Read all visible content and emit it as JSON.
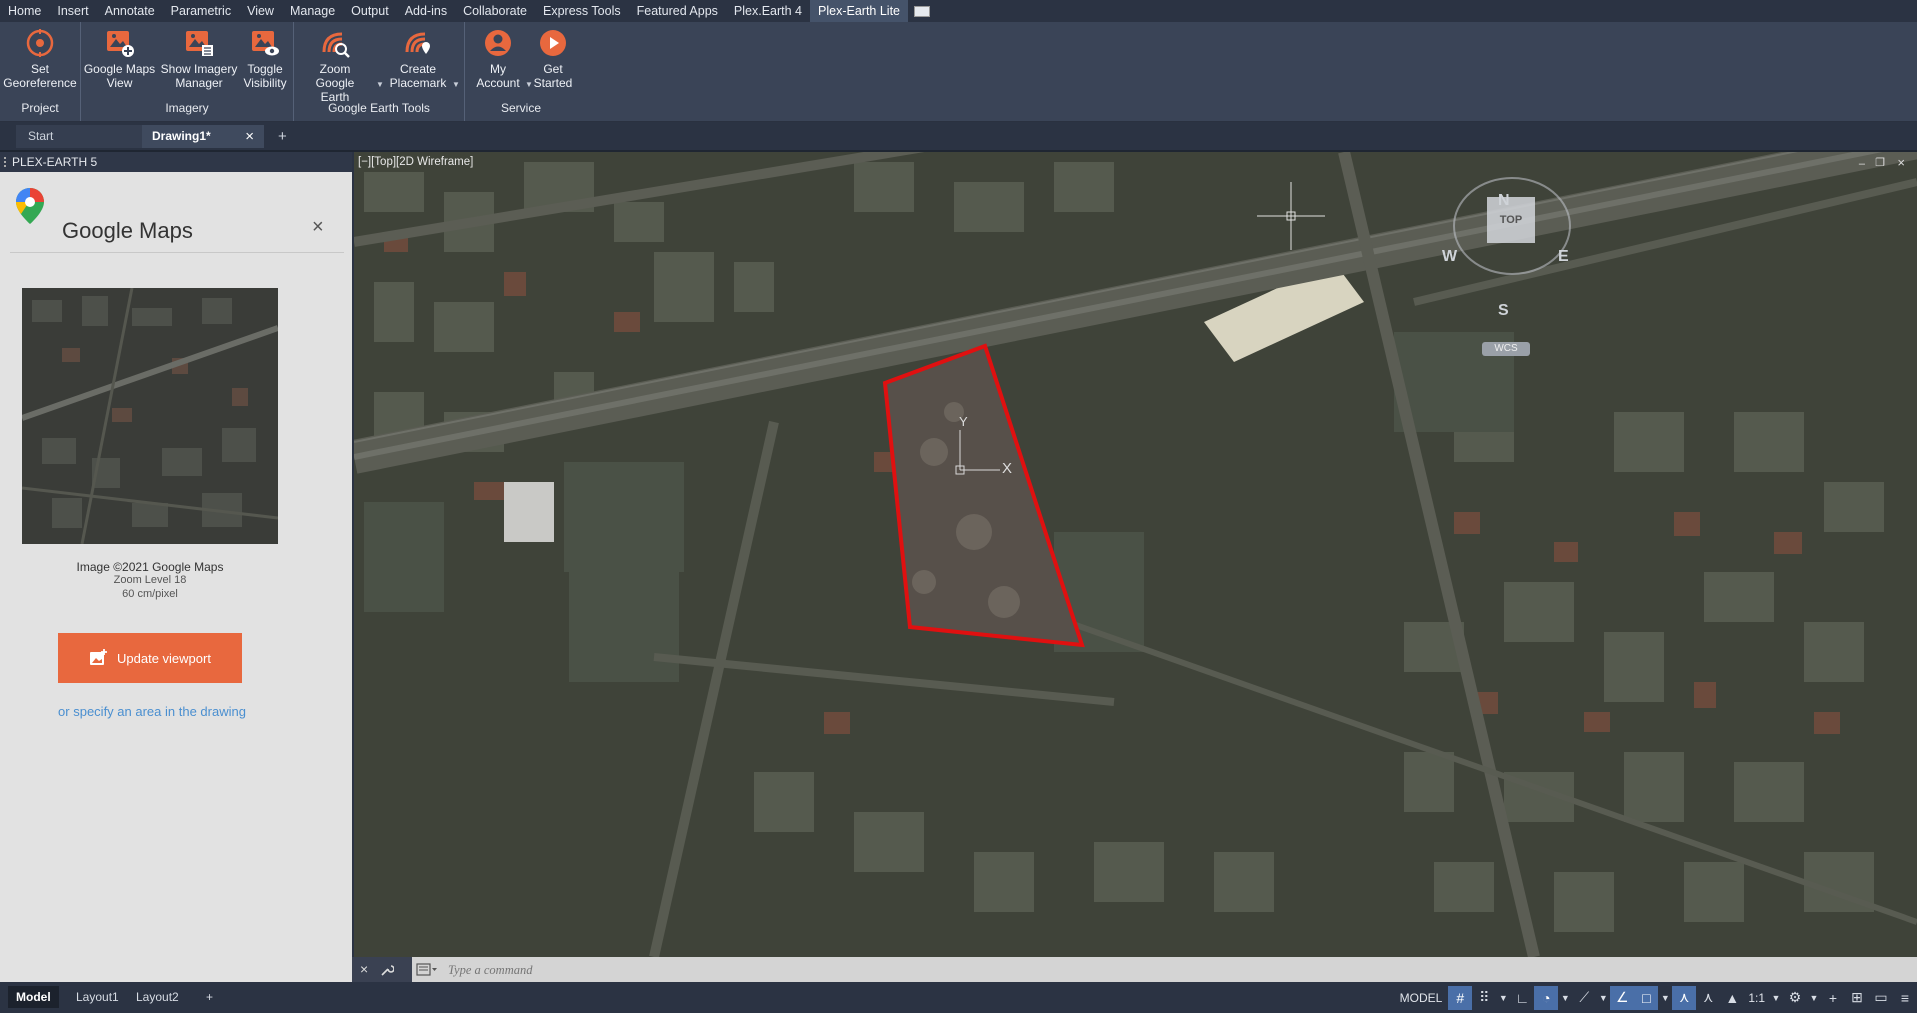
{
  "menu": {
    "items": [
      "Home",
      "Insert",
      "Annotate",
      "Parametric",
      "View",
      "Manage",
      "Output",
      "Add-ins",
      "Collaborate",
      "Express Tools",
      "Featured Apps",
      "Plex.Earth 4",
      "Plex-Earth Lite"
    ],
    "active_index": 12
  },
  "ribbon": {
    "panels": {
      "project": "Project",
      "imagery": "Imagery",
      "google_earth_tools": "Google Earth Tools",
      "service": "Service"
    },
    "tools": {
      "set_georeference": [
        "Set",
        "Georeference"
      ],
      "google_maps_view": [
        "Google Maps",
        "View"
      ],
      "show_imagery_manager": [
        "Show Imagery",
        "Manager"
      ],
      "toggle_visibility": [
        "Toggle",
        "Visibility"
      ],
      "zoom_google_earth": [
        "Zoom",
        "Google Earth"
      ],
      "create_placemark": [
        "Create",
        "Placemark"
      ],
      "my_account": [
        "My",
        "Account"
      ],
      "get_started": [
        "Get",
        "Started"
      ]
    },
    "accent": "#e8683e"
  },
  "doc_tabs": {
    "start": "Start",
    "drawing": "Drawing1*",
    "close_glyph": "×",
    "add_glyph": "+"
  },
  "side_panel": {
    "header": "PLEX-EARTH 5",
    "title": "Google Maps",
    "close_glyph": "×",
    "image_credit": "Image ©2021 Google Maps",
    "zoom_level": "Zoom Level 18",
    "resolution": "60 cm/pixel",
    "update_button": "Update viewport",
    "specify_link": "or specify an area in the drawing"
  },
  "viewport": {
    "label": "[−][Top][2D Wireframe]",
    "compass": {
      "n": "N",
      "s": "S",
      "e": "E",
      "w": "W",
      "top": "TOP",
      "wcs": "WCS"
    },
    "ucs": {
      "x": "X",
      "y": "Y"
    },
    "boundary_color": "#e01010"
  },
  "command": {
    "placeholder": "Type a command"
  },
  "status": {
    "layouts": [
      "Model",
      "Layout1",
      "Layout2"
    ],
    "add_glyph": "+",
    "model_label": "MODEL",
    "scale": "1:1"
  }
}
